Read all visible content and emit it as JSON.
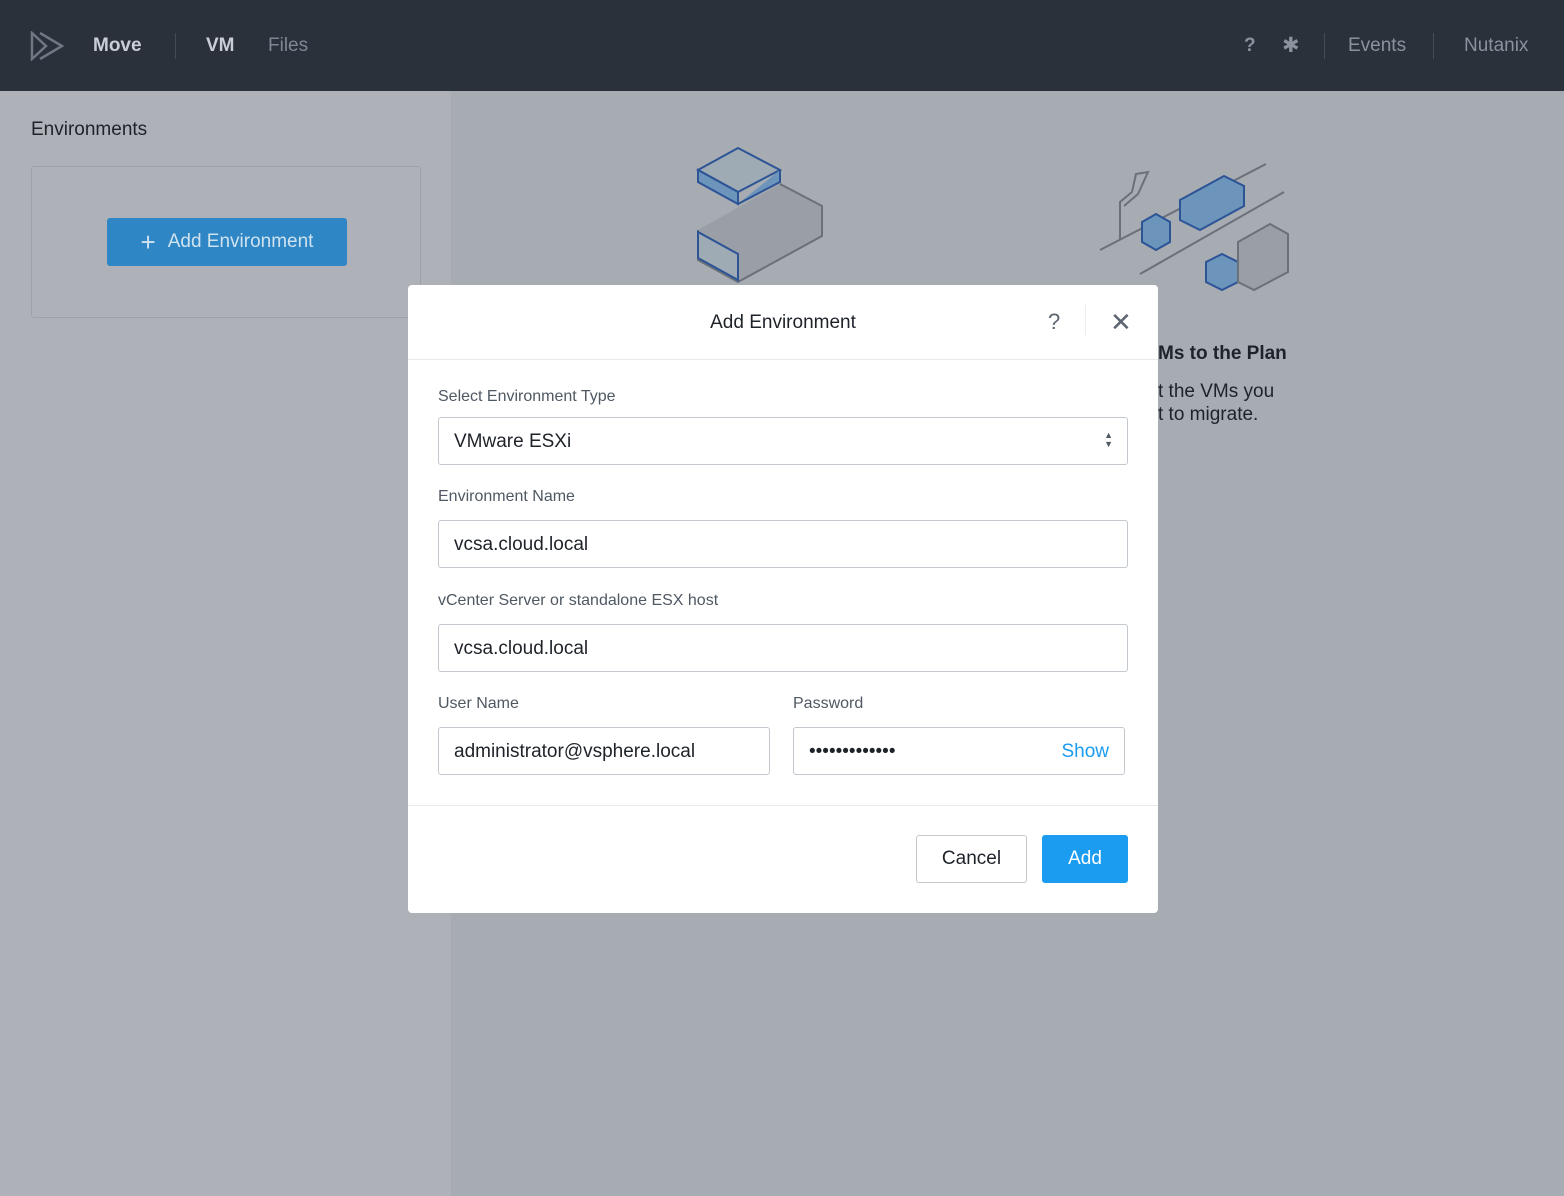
{
  "topbar": {
    "app": "Move",
    "nav": [
      "VM",
      "Files"
    ],
    "help": "?",
    "right": [
      "Events",
      "Nutanix"
    ]
  },
  "sidebar": {
    "title": "Environments",
    "add_button": "Add Environment"
  },
  "background": {
    "heading": "Ms to the Plan",
    "line1": "t the VMs you",
    "line2": "t to migrate."
  },
  "modal": {
    "title": "Add Environment",
    "help": "?",
    "close": "✕",
    "env_type_label": "Select Environment Type",
    "env_type_value": "VMware ESXi",
    "env_name_label": "Environment Name",
    "env_name_value": "vcsa.cloud.local",
    "host_label": "vCenter Server or standalone ESX host",
    "host_value": "vcsa.cloud.local",
    "user_label": "User Name",
    "user_value": "administrator@vsphere.local",
    "password_label": "Password",
    "password_value": "•••••••••••••",
    "show": "Show",
    "cancel": "Cancel",
    "add": "Add"
  },
  "colors": {
    "accent": "#1b9cf1",
    "topbar": "#2b313b"
  }
}
